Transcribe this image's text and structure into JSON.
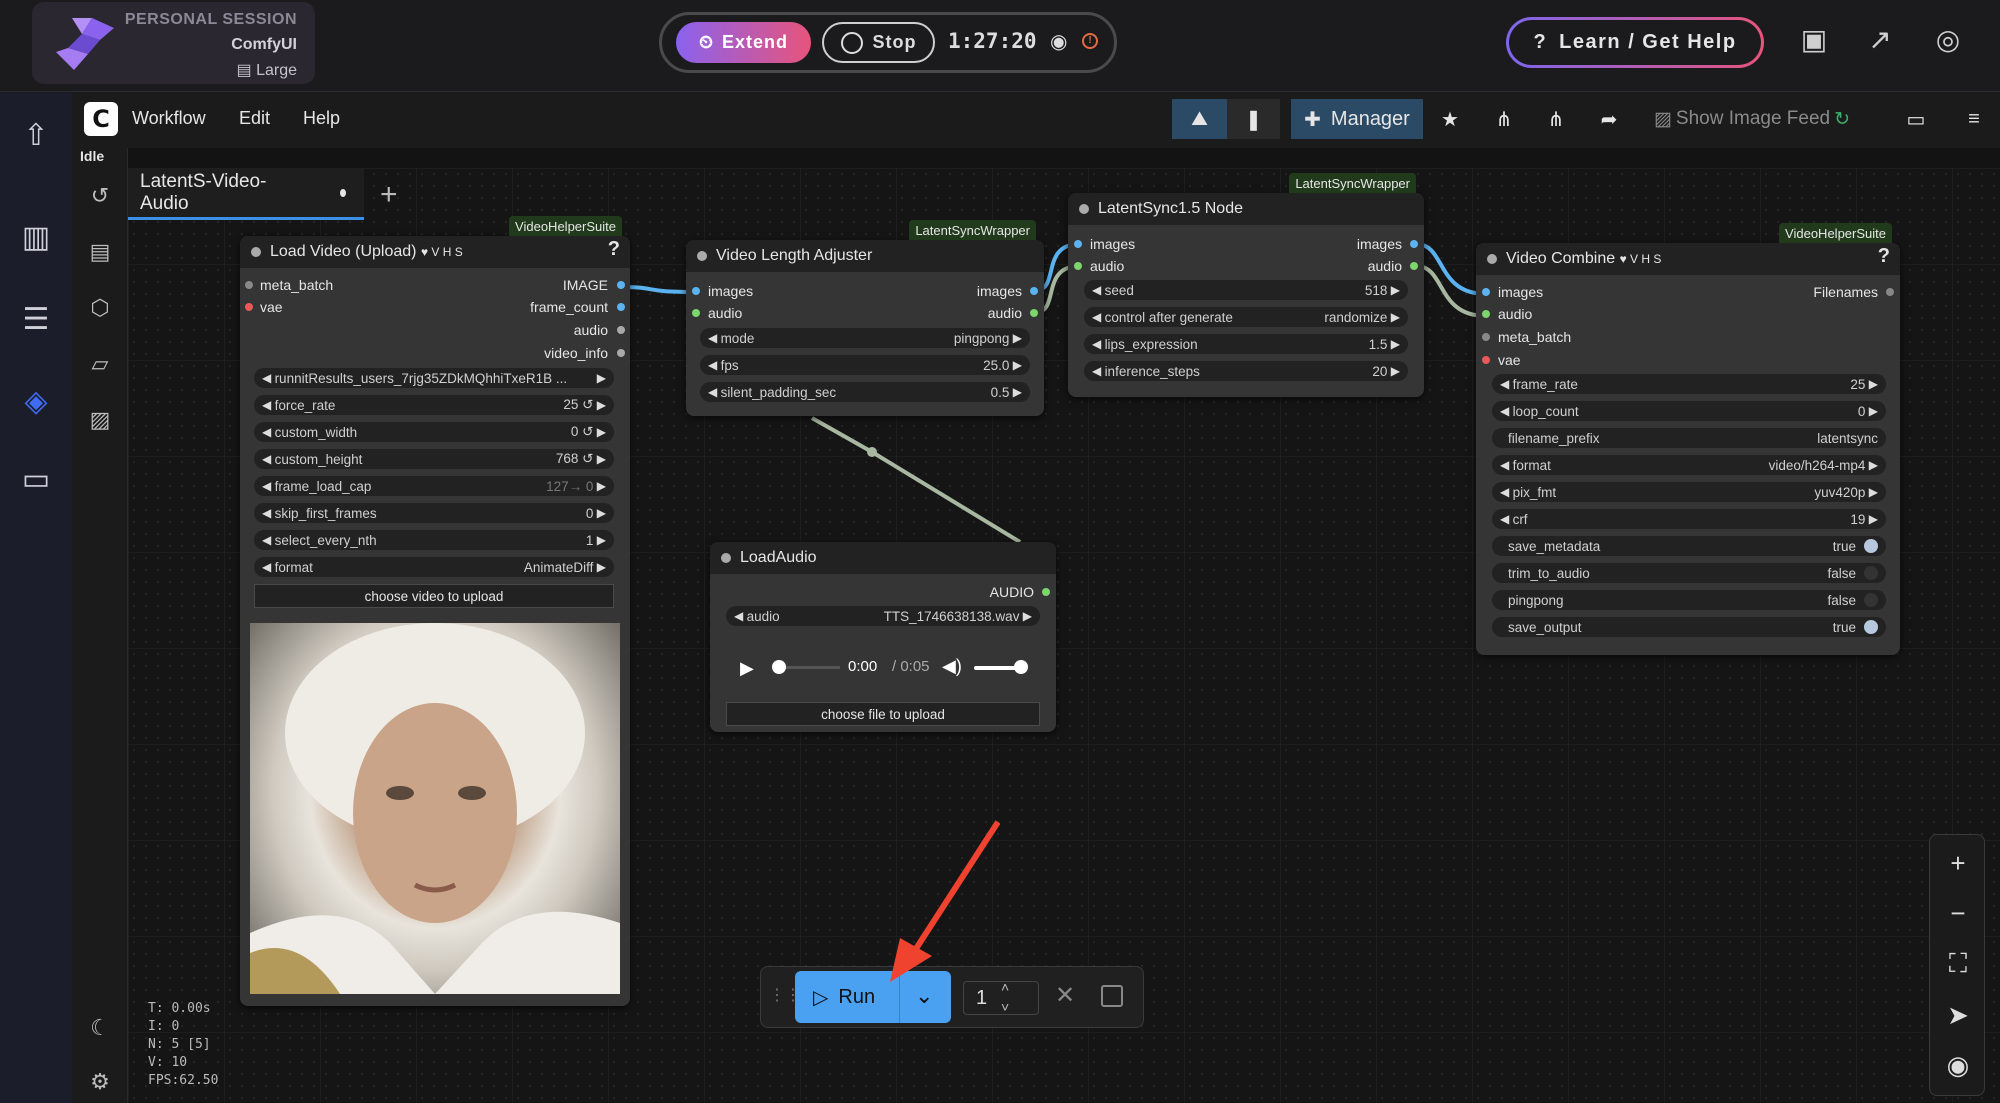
{
  "session": {
    "title": "PERSONAL SESSION",
    "app": "ComfyUI",
    "size": "Large"
  },
  "controls": {
    "extend": "Extend",
    "stop": "Stop",
    "timer": "1:27:20",
    "warn": "!"
  },
  "help": {
    "label": "Learn / Get Help"
  },
  "menu": {
    "workflow": "Workflow",
    "edit": "Edit",
    "help": "Help",
    "status": "Idle"
  },
  "toolbar": {
    "manager": "Manager",
    "feed": "Show Image Feed"
  },
  "tab": {
    "name": "LatentS-Video-Audio",
    "add": "+"
  },
  "nodes": {
    "load_video": {
      "badge": "VideoHelperSuite",
      "title": "Load Video (Upload)",
      "tag": "♥ V H S",
      "help": "?",
      "inputs": [
        "meta_batch",
        "vae"
      ],
      "outputs": [
        "IMAGE",
        "frame_count",
        "audio",
        "video_info"
      ],
      "widgets": [
        [
          "runnitResults_users_7rjg35ZDkMQhhiTxeR1B ...",
          ""
        ],
        [
          "force_rate",
          "25 ↺"
        ],
        [
          "custom_width",
          "0 ↺"
        ],
        [
          "custom_height",
          "768 ↺"
        ],
        [
          "frame_load_cap",
          "127→ 0"
        ],
        [
          "skip_first_frames",
          "0"
        ],
        [
          "select_every_nth",
          "1"
        ],
        [
          "format",
          "AnimateDiff"
        ]
      ],
      "upload": "choose video to upload"
    },
    "length_adj": {
      "badge": "LatentSyncWrapper",
      "title": "Video Length Adjuster",
      "inputs": [
        "images",
        "audio"
      ],
      "outputs": [
        "images",
        "audio"
      ],
      "widgets": [
        [
          "mode",
          "pingpong"
        ],
        [
          "fps",
          "25.0"
        ],
        [
          "silent_padding_sec",
          "0.5"
        ]
      ]
    },
    "latentsync": {
      "badge": "LatentSyncWrapper",
      "title": "LatentSync1.5 Node",
      "inputs": [
        "images",
        "audio"
      ],
      "outputs": [
        "images",
        "audio"
      ],
      "widgets": [
        [
          "seed",
          "518"
        ],
        [
          "control after generate",
          "randomize"
        ],
        [
          "lips_expression",
          "1.5"
        ],
        [
          "inference_steps",
          "20"
        ]
      ]
    },
    "combine": {
      "badge": "VideoHelperSuite",
      "title": "Video Combine",
      "tag": "♥ V H S",
      "help": "?",
      "inputs": [
        "images",
        "audio",
        "meta_batch",
        "vae"
      ],
      "outputs": [
        "Filenames"
      ],
      "widgets": [
        [
          "frame_rate",
          "25"
        ],
        [
          "loop_count",
          "0"
        ],
        [
          "filename_prefix",
          "latentsync"
        ],
        [
          "format",
          "video/h264-mp4"
        ],
        [
          "pix_fmt",
          "yuv420p"
        ],
        [
          "crf",
          "19"
        ]
      ],
      "toggles": [
        [
          "save_metadata",
          "true"
        ],
        [
          "trim_to_audio",
          "false"
        ],
        [
          "pingpong",
          "false"
        ],
        [
          "save_output",
          "true"
        ]
      ]
    },
    "load_audio": {
      "title": "LoadAudio",
      "output": "AUDIO",
      "widget": [
        "audio",
        "TTS_1746638138.wav"
      ],
      "time": "0:00",
      "duration": "/ 0:05",
      "upload": "choose file to upload"
    }
  },
  "run": {
    "label": "Run",
    "count": "1"
  },
  "stats": [
    "T: 0.00s",
    "I: 0",
    "N: 5 [5]",
    "V: 10",
    "FPS:62.50"
  ],
  "colors": {
    "accent": "#4aa1f2",
    "link_blue": "#5ab3f0",
    "link_green": "#a8b8a0",
    "badge": "#213a1c"
  }
}
